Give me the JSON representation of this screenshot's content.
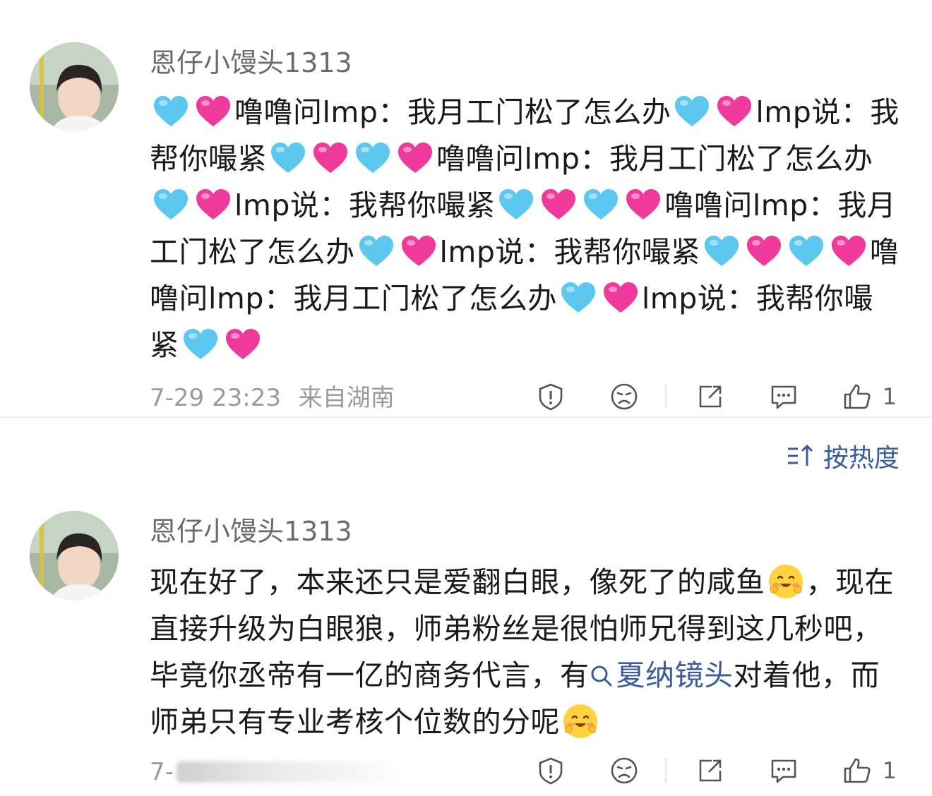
{
  "comments": [
    {
      "username": "恩仔小馒头1313",
      "segments": [
        {
          "t": "heart",
          "c": "blue"
        },
        {
          "t": "heart",
          "c": "pink"
        },
        {
          "t": "text",
          "v": "噜噜问lmp：我月工门松了怎么办"
        },
        {
          "t": "heart",
          "c": "blue"
        },
        {
          "t": "heart",
          "c": "pink"
        },
        {
          "t": "text",
          "v": "lmp说：我帮你嘬紧"
        },
        {
          "t": "heart",
          "c": "blue"
        },
        {
          "t": "heart",
          "c": "pink"
        },
        {
          "t": "heart",
          "c": "blue"
        },
        {
          "t": "heart",
          "c": "pink"
        },
        {
          "t": "text",
          "v": "噜噜问lmp：我月工门松了怎么办"
        },
        {
          "t": "heart",
          "c": "blue"
        },
        {
          "t": "heart",
          "c": "pink"
        },
        {
          "t": "text",
          "v": "lmp说：我帮你嘬紧"
        },
        {
          "t": "heart",
          "c": "blue"
        },
        {
          "t": "heart",
          "c": "pink"
        },
        {
          "t": "heart",
          "c": "blue"
        },
        {
          "t": "heart",
          "c": "pink"
        },
        {
          "t": "text",
          "v": "噜噜问lmp：我月工门松了怎么办"
        },
        {
          "t": "heart",
          "c": "blue"
        },
        {
          "t": "heart",
          "c": "pink"
        },
        {
          "t": "text",
          "v": "lmp说：我帮你嘬紧"
        },
        {
          "t": "heart",
          "c": "blue"
        },
        {
          "t": "heart",
          "c": "pink"
        },
        {
          "t": "heart",
          "c": "blue"
        },
        {
          "t": "heart",
          "c": "pink"
        },
        {
          "t": "text",
          "v": "噜噜问lmp：我月工门松了怎么办"
        },
        {
          "t": "heart",
          "c": "blue"
        },
        {
          "t": "heart",
          "c": "pink"
        },
        {
          "t": "text",
          "v": "lmp说：我帮你嘬紧"
        },
        {
          "t": "heart",
          "c": "blue"
        },
        {
          "t": "heart",
          "c": "pink"
        }
      ],
      "timestamp": "7-29 23:23",
      "location": "来自湖南",
      "like_count": "1"
    },
    {
      "username": "恩仔小馒头1313",
      "segments": [
        {
          "t": "text",
          "v": "现在好了，本来还只是爱翻白眼，像死了的咸鱼"
        },
        {
          "t": "smiley"
        },
        {
          "t": "text",
          "v": "，现在直接升级为白眼狼，师弟粉丝是很怕师兄得到这几秒吧，毕竟你丞帝有一亿的商务代言，有"
        },
        {
          "t": "link",
          "v": "夏纳镜头"
        },
        {
          "t": "text",
          "v": "对着他，而师弟只有专业考核个位数的分呢"
        },
        {
          "t": "smiley"
        }
      ],
      "timestamp": "7-",
      "like_count": "1"
    }
  ],
  "sort": {
    "label": "按热度"
  },
  "colors": {
    "link": "#3b5b9c",
    "heart_blue": "#5cc8ef",
    "heart_pink": "#f03a9b",
    "meta_text": "#9a9a9a"
  },
  "icons": [
    "report-icon",
    "dislike-icon",
    "share-icon",
    "comment-icon",
    "like-icon",
    "sort-icon",
    "search-icon"
  ]
}
